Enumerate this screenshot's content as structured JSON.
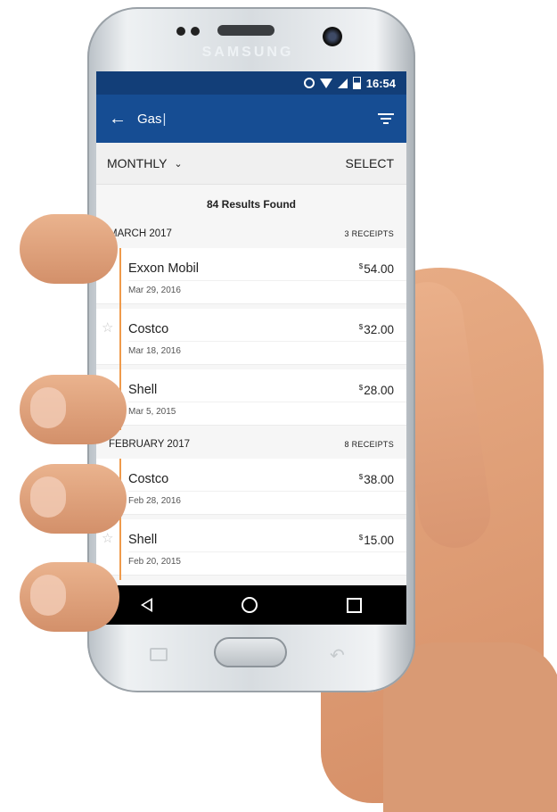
{
  "device": {
    "brand": "SAMSUNG"
  },
  "status_bar": {
    "time": "16:54"
  },
  "app_bar": {
    "search_query": "Gas"
  },
  "sub_bar": {
    "period_label": "MONTHLY",
    "select_label": "SELECT"
  },
  "results": {
    "summary": "84 Results Found"
  },
  "sections": [
    {
      "label": "MARCH 2017",
      "count": "3 RECEIPTS",
      "receipts": [
        {
          "merchant": "Exxon Mobil",
          "date": "Mar 29, 2016",
          "currency": "$",
          "amount": "54.00"
        },
        {
          "merchant": "Costco",
          "date": "Mar 18, 2016",
          "currency": "$",
          "amount": "32.00"
        },
        {
          "merchant": "Shell",
          "date": "Mar 5, 2015",
          "currency": "$",
          "amount": "28.00"
        }
      ]
    },
    {
      "label": "FEBRUARY 2017",
      "count": "8 RECEIPTS",
      "receipts": [
        {
          "merchant": "Costco",
          "date": "Feb 28, 2016",
          "currency": "$",
          "amount": "38.00"
        },
        {
          "merchant": "Shell",
          "date": "Feb 20, 2015",
          "currency": "$",
          "amount": "15.00"
        }
      ]
    }
  ],
  "icons": {
    "status": [
      "alarm-icon",
      "wifi-icon",
      "signal-icon",
      "battery-icon"
    ],
    "app_bar": [
      "back-arrow-icon",
      "filter-icon"
    ],
    "nav": [
      "nav-back-icon",
      "nav-home-icon",
      "nav-recent-icon"
    ],
    "receipt": "star-icon"
  },
  "colors": {
    "status_bar": "#123e78",
    "app_bar": "#164d93",
    "accent": "#ef9a4b"
  }
}
